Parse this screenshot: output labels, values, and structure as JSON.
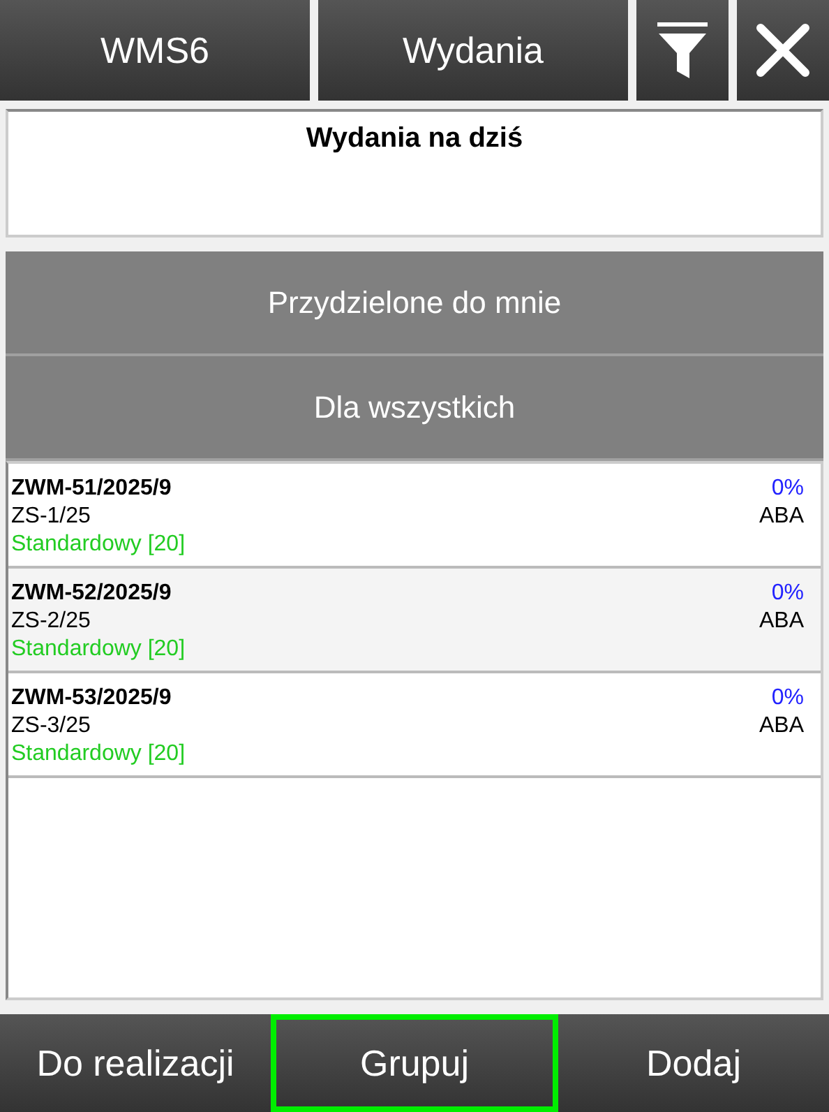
{
  "top_bar": {
    "app": "WMS6",
    "title": "Wydania"
  },
  "header": {
    "title": "Wydania na dziś"
  },
  "groups": [
    {
      "label": "Przydzielone do mnie"
    },
    {
      "label": "Dla wszystkich"
    }
  ],
  "list": [
    {
      "number": "ZWM-51/2025/9",
      "document": "ZS-1/25",
      "type": "Standardowy [20]",
      "progress": "0%",
      "client": "ABA"
    },
    {
      "number": "ZWM-52/2025/9",
      "document": "ZS-2/25",
      "type": "Standardowy [20]",
      "progress": "0%",
      "client": "ABA"
    },
    {
      "number": "ZWM-53/2025/9",
      "document": "ZS-3/25",
      "type": "Standardowy [20]",
      "progress": "0%",
      "client": "ABA"
    }
  ],
  "bottom_buttons": [
    {
      "label": "Do realizacji",
      "selected": false
    },
    {
      "label": "Grupuj",
      "selected": true
    },
    {
      "label": "Dodaj",
      "selected": false
    }
  ]
}
